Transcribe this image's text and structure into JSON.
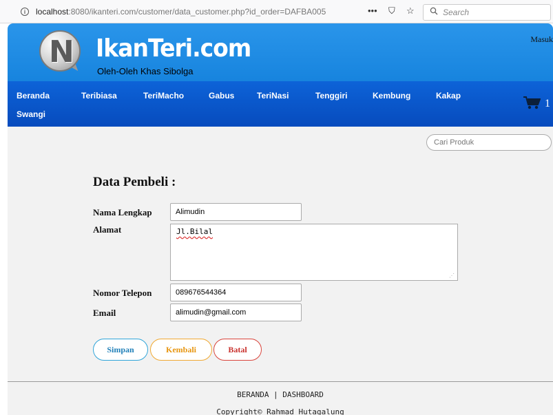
{
  "browser": {
    "url_host": "localhost",
    "url_rest": ":8080/ikanteri.com/customer/data_customer.php?id_order=DAFBA005",
    "info_icon": "i",
    "more_icon": "•••",
    "pocket_icon": "⛉",
    "bookmark_icon": "☆",
    "search_icon": "⚲",
    "search_placeholder": "Search"
  },
  "site": {
    "brand_name": "IkanTeri.com",
    "tagline": "Oleh-Oleh Khas Sibolga",
    "login_link": "Masuk"
  },
  "nav": {
    "items": [
      "Beranda",
      "Teribiasa",
      "TeriMacho",
      "Gabus",
      "TeriNasi",
      "Tenggiri",
      "Kembung",
      "Kakap",
      "Swangi"
    ],
    "cart_count": "1"
  },
  "search": {
    "placeholder": "Cari Produk"
  },
  "form": {
    "title": "Data Pembeli :",
    "name_label": "Nama Lengkap",
    "name_value": "Alimudin",
    "address_label": "Alamat",
    "address_value": "Jl.Bilal",
    "phone_label": "Nomor Telepon",
    "phone_value": "089676544364",
    "email_label": "Email",
    "email_value": "alimudin@gmail.com"
  },
  "buttons": {
    "save": "Simpan",
    "back": "Kembali",
    "cancel": "Batal"
  },
  "footer": {
    "links": "BERANDA | DASHBOARD",
    "copyright": "Copyright© Rahmad Hutagalung"
  },
  "colors": {
    "header_blue": "#1a8ae6",
    "nav_blue": "#0a56c9",
    "save_color": "#2ea4d9",
    "back_color": "#f0a830",
    "cancel_color": "#d9433a"
  }
}
